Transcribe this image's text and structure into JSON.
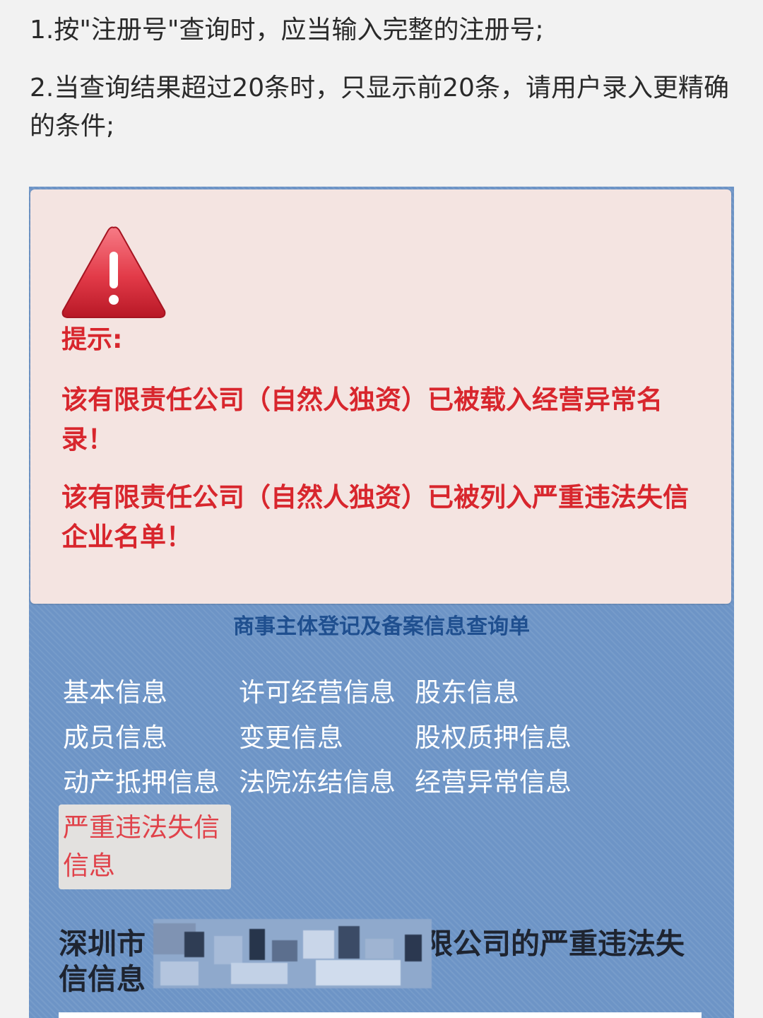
{
  "notes": {
    "line1": "1.按\"注册号\"查询时，应当输入完整的注册号;",
    "line2": "2.当查询结果超过20条时，只显示前20条，请用户录入更精确的条件;"
  },
  "alert": {
    "title": "提示:",
    "message1": "该有限责任公司（自然人独资）已被载入经营异常名录！",
    "message2": "该有限责任公司（自然人独资）已被列入严重违法失信企业名单！"
  },
  "form": {
    "title": "商事主体登记及备案信息查询单",
    "links": [
      "基本信息",
      "许可经营信息",
      "股东信息",
      "成员信息",
      "变更信息",
      "股权质押信息",
      "动产抵押信息",
      "法院冻结信息",
      "经营异常信息",
      "严重违法失信信息"
    ],
    "active_link": "严重违法失信信息"
  },
  "company_heading": {
    "prefix": "深圳市",
    "suffix": "限公司的严重违法失信信息"
  },
  "colors": {
    "panel": "#6d94c6",
    "alert_bg": "#f4e4e1",
    "alert_text": "#d8262d",
    "form_title": "#1f4f8f",
    "active_link_text": "#e0424a"
  },
  "icons": {
    "warning": "warning-triangle-icon"
  }
}
